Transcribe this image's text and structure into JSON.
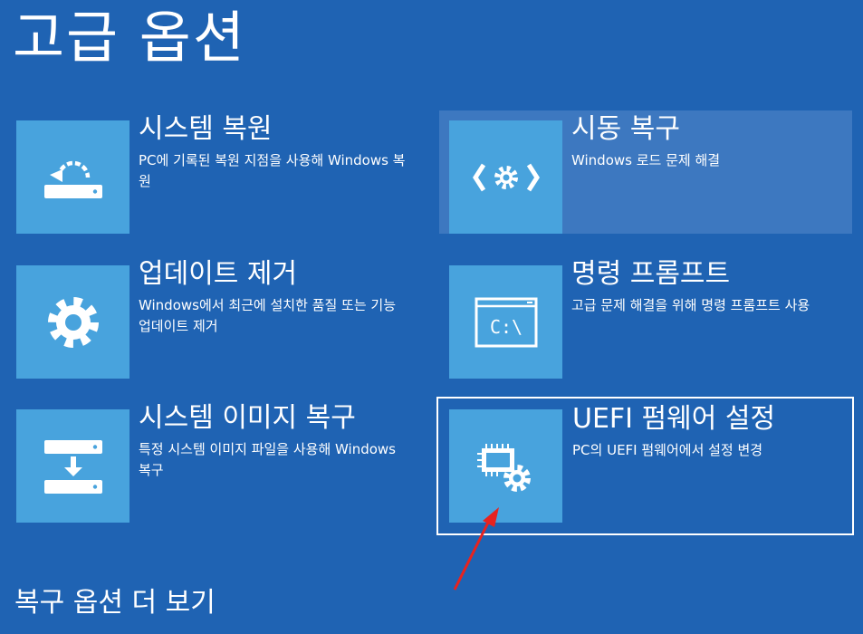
{
  "page": {
    "title": "고급 옵션"
  },
  "options": [
    {
      "title": "시스템 복원",
      "desc": "PC에 기록된 복원 지점을 사용해 Windows 복원",
      "icon": "system-restore-icon"
    },
    {
      "title": "시동 복구",
      "desc": "Windows 로드 문제 해결",
      "icon": "startup-repair-icon"
    },
    {
      "title": "업데이트 제거",
      "desc": "Windows에서 최근에 설치한 품질 또는 기능 업데이트 제거",
      "icon": "gear-icon"
    },
    {
      "title": "명령 프롬프트",
      "desc": "고급 문제 해결을 위해 명령 프롬프트 사용",
      "icon": "command-prompt-icon",
      "prompt_text": "C:\\"
    },
    {
      "title": "시스템 이미지 복구",
      "desc": "특정 시스템 이미지 파일을 사용해 Windows 복구",
      "icon": "system-image-icon"
    },
    {
      "title": "UEFI 펌웨어 설정",
      "desc": "PC의 UEFI 펌웨어에서 설정 변경",
      "icon": "uefi-firmware-icon"
    }
  ],
  "footer": {
    "more_options": "복구 옵션 더 보기"
  },
  "colors": {
    "background": "#1f63b3",
    "tile": "#48a3dd",
    "hover": "#3d78c0",
    "annotation_arrow": "#e8231f"
  }
}
